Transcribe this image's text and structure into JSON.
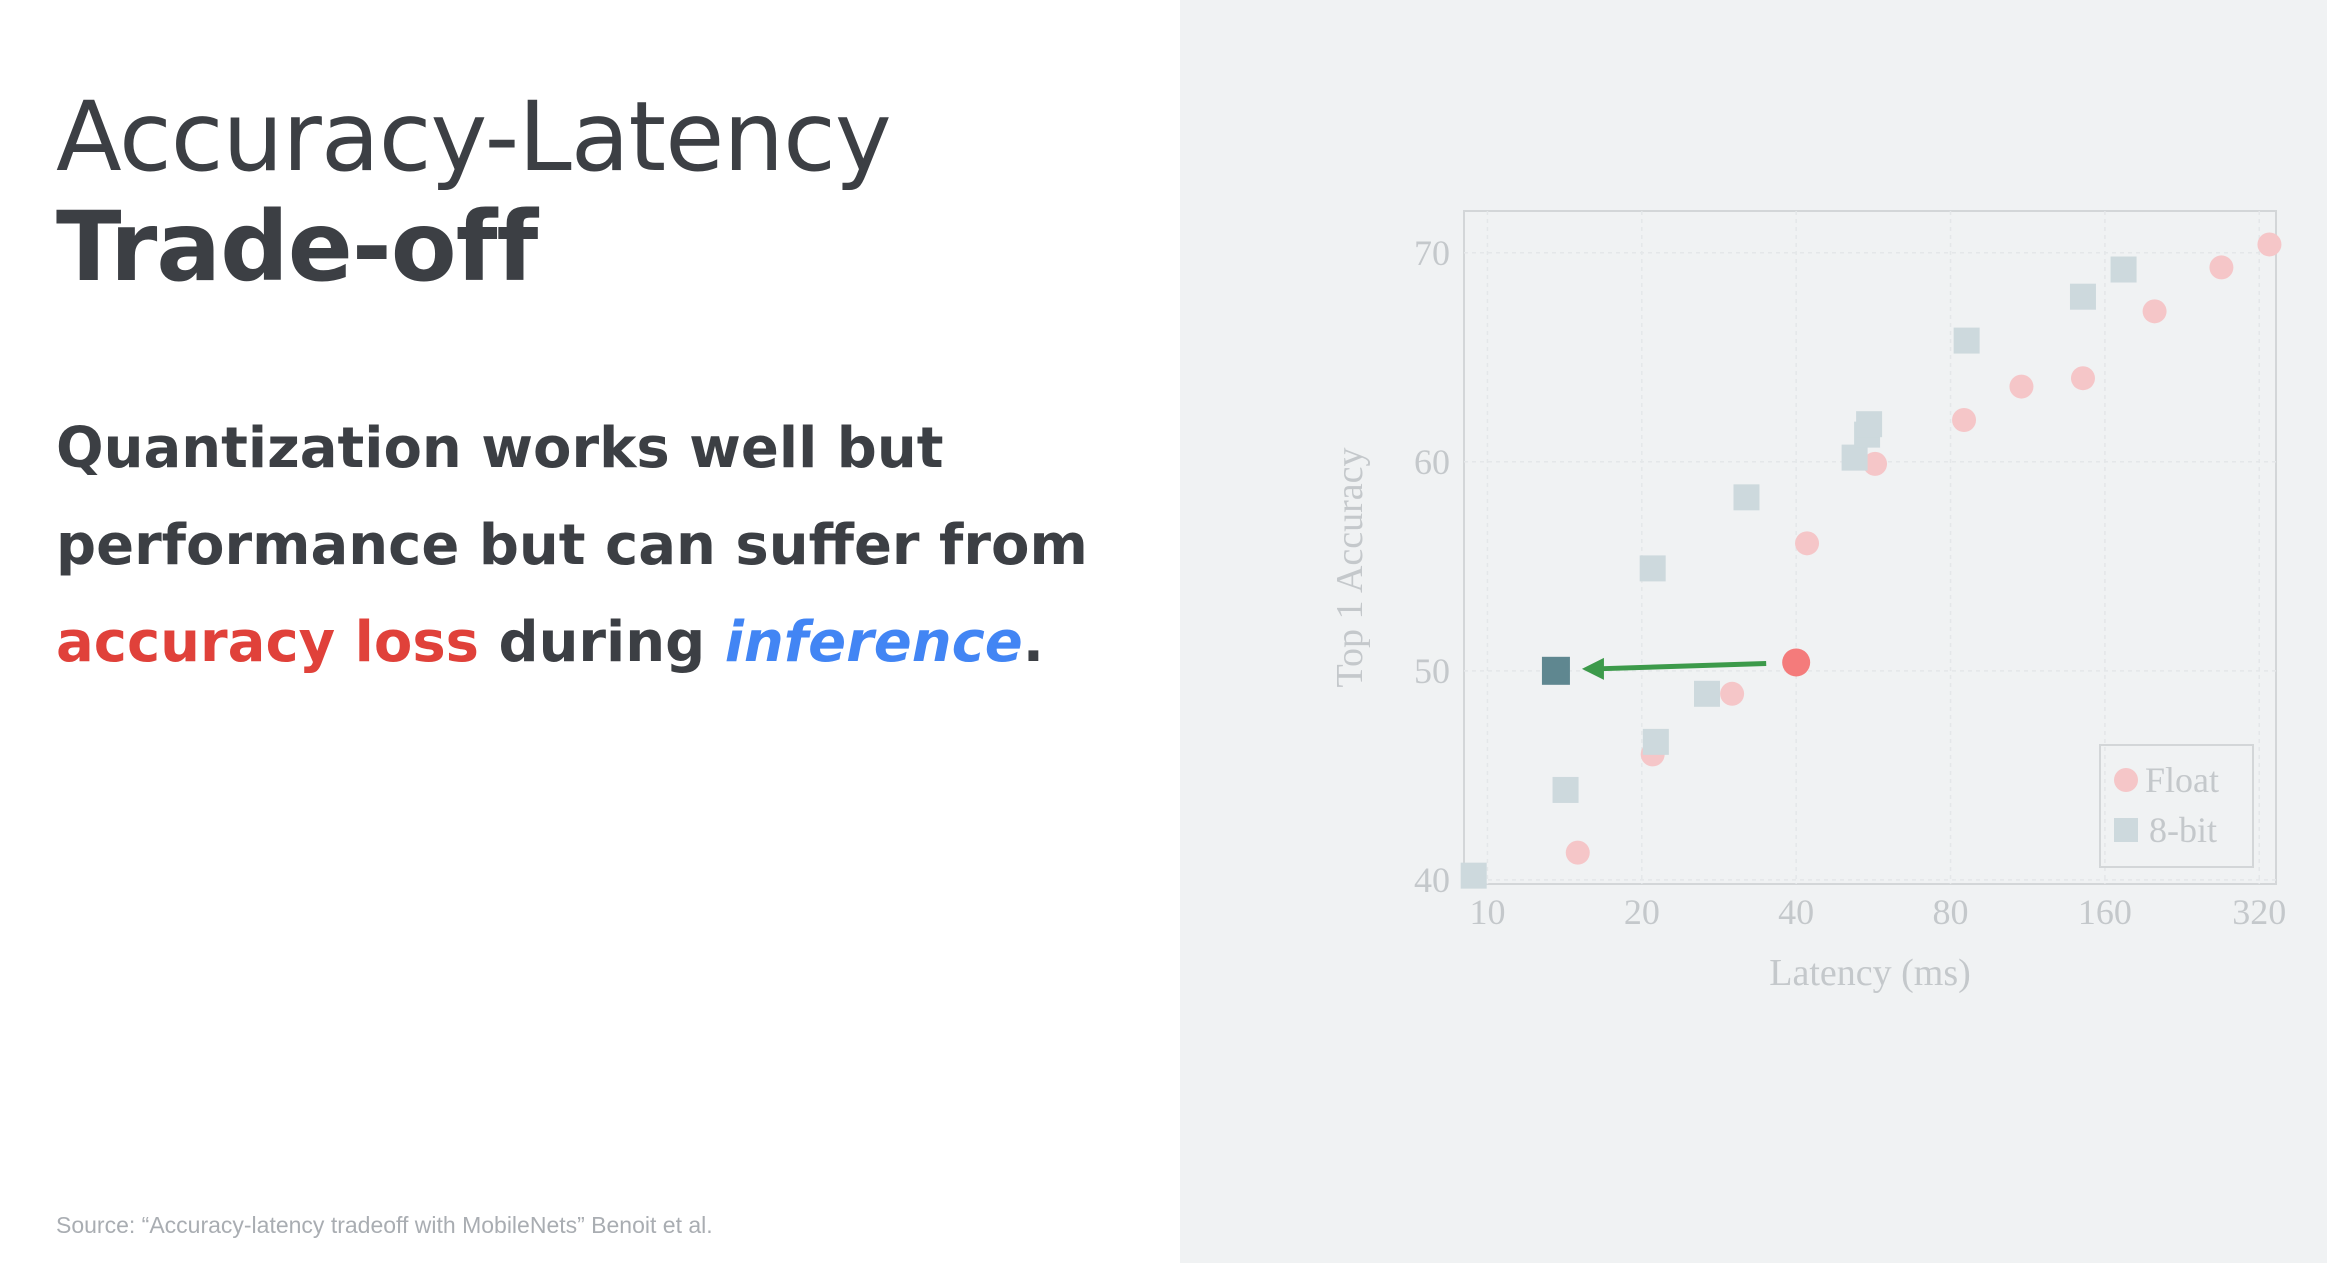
{
  "slide": {
    "title_line1": "Accuracy-Latency",
    "title_line2": "Trade-off",
    "body_line1": "Quantization works well but",
    "body_line2": "performance but can suffer from",
    "body_highlight_red": "accuracy loss",
    "body_mid": " during ",
    "body_highlight_blue": "inference",
    "body_end": ".",
    "source": "Source: “Accuracy-latency tradeoff with MobileNets” Benoit et al."
  },
  "colors": {
    "accent_red": "#e0413a",
    "accent_blue": "#4285f4",
    "float_marker": "#f5c6c8",
    "int8_marker": "#cdd9dd",
    "highlight_float": "#f47b7b",
    "highlight_int8": "#5f8790",
    "arrow": "#3c9a4a",
    "right_panel_bg": "#f0f2f3"
  },
  "chart_data": {
    "type": "scatter",
    "xlabel": "Latency (ms)",
    "ylabel": "Top 1 Accuracy",
    "xscale": "log2",
    "xlim": [
      9,
      345
    ],
    "ylim": [
      39.8,
      72
    ],
    "xticks": [
      10,
      20,
      40,
      80,
      160,
      320
    ],
    "xtick_labels": [
      "10",
      "20",
      "40",
      "80",
      "160",
      "320"
    ],
    "yticks": [
      40,
      50,
      60,
      70
    ],
    "ytick_labels": [
      "40",
      "50",
      "60",
      70
    ],
    "grid": true,
    "legend_position": "bottom-right",
    "series": [
      {
        "name": "Float",
        "marker": "circle",
        "points": [
          [
            15,
            41.3
          ],
          [
            21,
            46.0
          ],
          [
            30,
            48.9
          ],
          [
            42,
            56.1
          ],
          [
            57,
            59.9
          ],
          [
            85,
            62.0
          ],
          [
            110,
            63.6
          ],
          [
            145,
            64.0
          ],
          [
            200,
            67.2
          ],
          [
            270,
            69.3
          ],
          [
            335,
            70.4
          ]
        ]
      },
      {
        "name": "8-bit",
        "marker": "square",
        "points": [
          [
            9.4,
            40.2
          ],
          [
            14.2,
            44.3
          ],
          [
            21,
            54.9
          ],
          [
            21.3,
            46.6
          ],
          [
            26.8,
            48.9
          ],
          [
            32,
            58.3
          ],
          [
            52,
            60.2
          ],
          [
            55,
            61.3
          ],
          [
            55.5,
            61.8
          ],
          [
            86,
            65.8
          ],
          [
            145,
            67.9
          ],
          [
            174,
            69.2
          ]
        ]
      }
    ],
    "highlight": {
      "from": {
        "series": "Float",
        "x": 40,
        "y": 50.4
      },
      "to": {
        "series": "8-bit",
        "x": 13.6,
        "y": 50.0
      }
    }
  }
}
